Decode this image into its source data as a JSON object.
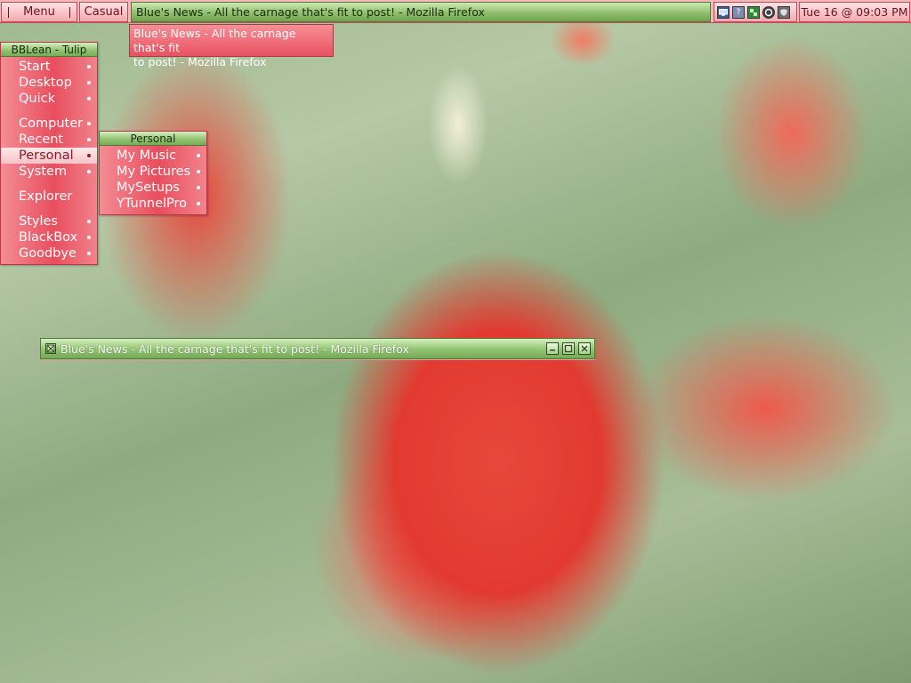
{
  "toolbar": {
    "menu_label": "Menu",
    "workspace_label": "Casual",
    "task_title": "Blue's News - All the carnage that's fit to post! - Mozilla Firefox",
    "tray_icons": [
      "monitor-icon",
      "help-icon",
      "network-icon",
      "skype-icon",
      "shield-icon"
    ],
    "tray_help_glyph": "?",
    "clock": "Tue 16 @ 09:03 PM"
  },
  "tooltip": {
    "line1": "Blue's News - All the carnage that's fit",
    "line2": "to post! - Mozilla Firefox"
  },
  "menu": {
    "title": "BBLean - Tulip",
    "items": [
      {
        "label": "Start"
      },
      {
        "label": "Desktop"
      },
      {
        "label": "Quick"
      },
      {
        "label": "Computer"
      },
      {
        "label": "Recent"
      },
      {
        "label": "Personal"
      },
      {
        "label": "System"
      },
      {
        "label": "Explorer"
      },
      {
        "label": "Styles"
      },
      {
        "label": "BlackBox"
      },
      {
        "label": "Goodbye"
      }
    ]
  },
  "submenu": {
    "title": "Personal",
    "items": [
      {
        "label": "My Music"
      },
      {
        "label": "My Pictures"
      },
      {
        "label": "MySetups"
      },
      {
        "label": "YTunnelPro"
      }
    ]
  },
  "window": {
    "title": "Blue's News - All the carnage that's fit to post! - Mozilla Firefox"
  },
  "colors": {
    "accent_red": "#e94e5d",
    "accent_green": "#95c676",
    "toolbar_pink": "#f7b8bc"
  }
}
